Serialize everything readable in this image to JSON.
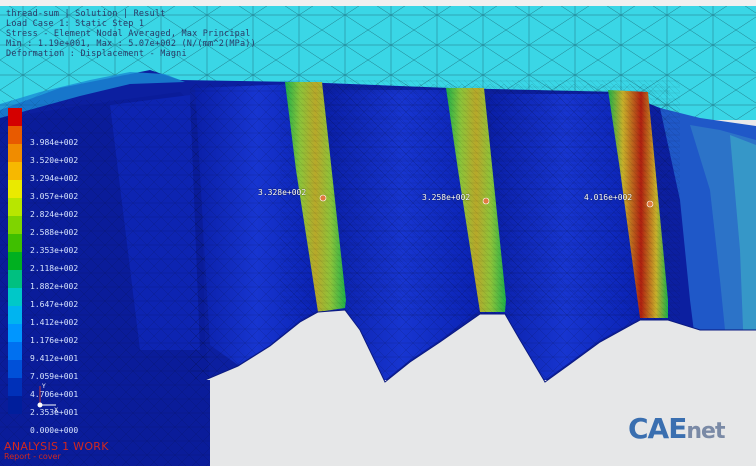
{
  "header": {
    "line1": "thread-sum | Solution | Result",
    "line2": "Load Case 1: Static Step 1",
    "line3": "Stress - Element Nodal Averaged, Max Principal",
    "line4": "Min : 1.19e+001, Max : 5.07e+002 (N/(mm^2(MPa))",
    "line5": "Deformation : Displacement - Magni"
  },
  "legend": {
    "labels": [
      "",
      "3.984e+002",
      "3.520e+002",
      "3.294e+002",
      "3.057e+002",
      "2.824e+002",
      "2.588e+002",
      "2.353e+002",
      "2.118e+002",
      "1.882e+002",
      "1.647e+002",
      "1.412e+002",
      "1.176e+002",
      "9.412e+001",
      "7.059e+001",
      "4.706e+001",
      "2.353e+001",
      "0.000e+000"
    ],
    "colors": [
      "#d40000",
      "#e85a00",
      "#f08c00",
      "#f7b800",
      "#eaea00",
      "#b8e600",
      "#7fd400",
      "#3fbf00",
      "#00b020",
      "#00c080",
      "#00c8c8",
      "#00b4f0",
      "#0096ff",
      "#0070f0",
      "#0050d8",
      "#0030b8",
      "#001e9c"
    ]
  },
  "probes": {
    "p1": "3.328e+002",
    "p2": "3.258e+002",
    "p3": "4.016e+002"
  },
  "footer": {
    "analysis": "ANALYSIS 1 WORK",
    "subtitle": "Report - cover",
    "logo_c": "CAE",
    "logo_n": "net"
  },
  "triad": {
    "x": "X",
    "y": "Y"
  }
}
